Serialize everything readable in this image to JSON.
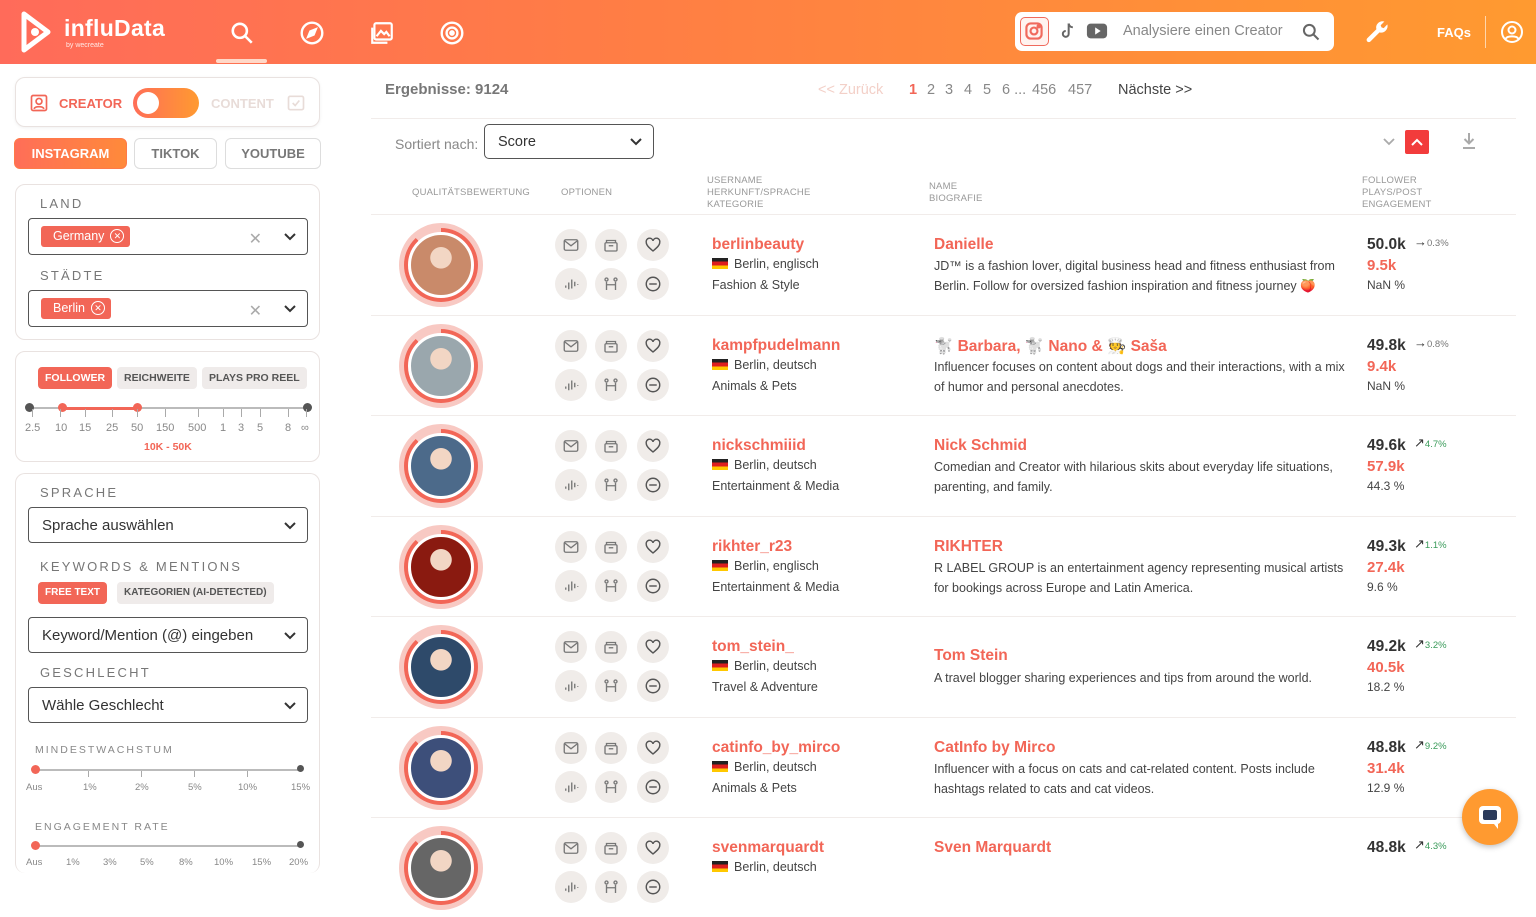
{
  "app": {
    "brand": "influData",
    "brand_sub": "by wecreate"
  },
  "topbar": {
    "nav_icons": [
      "search-icon",
      "compass-icon",
      "gallery-icon",
      "campaign-icon"
    ],
    "search_placeholder": "Analysiere einen Creator",
    "platform_icons": [
      "instagram-icon",
      "tiktok-icon",
      "youtube-icon"
    ],
    "faqs_label": "FAQs"
  },
  "sidebar": {
    "creator_label": "CREATOR",
    "content_label": "CONTENT",
    "platform_tabs": [
      "INSTAGRAM",
      "TIKTOK",
      "YOUTUBE"
    ],
    "land": {
      "title": "LAND",
      "chip": "Germany"
    },
    "staedte": {
      "title": "STÄDTE",
      "chip": "Berlin"
    },
    "metric_tabs": [
      "FOLLOWER",
      "REICHWEITE",
      "PLAYS PRO REEL"
    ],
    "follower_ticks": [
      "2.5",
      "10",
      "15",
      "25",
      "50",
      "150",
      "500",
      "1",
      "3",
      "5",
      "8",
      "∞"
    ],
    "follower_range": "10K - 50K",
    "sprache": {
      "title": "SPRACHE",
      "placeholder": "Sprache auswählen"
    },
    "keywords": {
      "title": "KEYWORDS & MENTIONS",
      "tabs": [
        "FREE TEXT",
        "KATEGORIEN (AI-DETECTED)"
      ],
      "placeholder": "Keyword/Mention (@) eingeben"
    },
    "geschlecht": {
      "title": "GESCHLECHT",
      "placeholder": "Wähle Geschlecht"
    },
    "wachstum": {
      "title": "MINDESTWACHSTUM",
      "ticks": [
        "Aus",
        "1%",
        "2%",
        "5%",
        "10%",
        "15%"
      ]
    },
    "engagement": {
      "title": "ENGAGEMENT RATE",
      "ticks": [
        "Aus",
        "1%",
        "3%",
        "5%",
        "8%",
        "10%",
        "15%",
        "20%"
      ]
    }
  },
  "main": {
    "results_label": "Ergebnisse: 9124",
    "pagination": {
      "prev": "<< Zurück",
      "pages": [
        "1",
        "2",
        "3",
        "4",
        "5",
        "6 ...",
        "456",
        "457"
      ],
      "current": "1",
      "next": "Nächste >>"
    },
    "sort": {
      "label": "Sortiert nach:",
      "value": "Score"
    },
    "headers": {
      "quality": "QUALITÄTSBEWERTUNG",
      "options": "OPTIONEN",
      "user": [
        "USERNAME",
        "HERKUNFT/SPRACHE",
        "KATEGORIE"
      ],
      "name": [
        "NAME",
        "BIOGRAFIE"
      ],
      "stats": [
        "FOLLOWER",
        "PLAYS/POST",
        "ENGAGEMENT"
      ]
    },
    "rows": [
      {
        "username": "berlinbeauty",
        "origin": "Berlin, englisch",
        "category": "Fashion & Style",
        "name": "Danielle",
        "bio": "JD™ is a fashion lover, digital business head and fitness enthusiast from Berlin. Follow for oversized fashion inspiration and fitness journey 🍑",
        "followers": "50.0k",
        "growth": "0.3%",
        "growth_dir": "flat",
        "plays": "9.5k",
        "engagement": "NaN %",
        "avatar_color": "#c98a6a"
      },
      {
        "username": "kampfpudelmann",
        "origin": "Berlin, deutsch",
        "category": "Animals & Pets",
        "name": "🐩 Barbara, 🐩 Nano & 🧑‍🍳 Saša",
        "bio": "Influencer focuses on content about dogs and their interactions, with a mix of humor and personal anecdotes.",
        "followers": "49.8k",
        "growth": "0.8%",
        "growth_dir": "flat",
        "plays": "9.4k",
        "engagement": "NaN %",
        "avatar_color": "#9aa7ad"
      },
      {
        "username": "nickschmiiid",
        "origin": "Berlin, deutsch",
        "category": "Entertainment & Media",
        "name": "Nick Schmid",
        "bio": "Comedian and Creator with hilarious skits about everyday life situations, parenting, and family.",
        "followers": "49.6k",
        "growth": "4.7%",
        "growth_dir": "up",
        "plays": "57.9k",
        "engagement": "44.3 %",
        "avatar_color": "#4c6a8a"
      },
      {
        "username": "rikhter_r23",
        "origin": "Berlin, englisch",
        "category": "Entertainment & Media",
        "name": "RIKHTER",
        "bio": "R LABEL GROUP is an entertainment agency representing musical artists for bookings across Europe and Latin America.",
        "followers": "49.3k",
        "growth": "1.1%",
        "growth_dir": "up",
        "plays": "27.4k",
        "engagement": "9.6 %",
        "avatar_color": "#8a1a10"
      },
      {
        "username": "tom_stein_",
        "origin": "Berlin, deutsch",
        "category": "Travel & Adventure",
        "name": "Tom Stein",
        "bio": "A travel blogger sharing experiences and tips from around the world.",
        "followers": "49.2k",
        "growth": "3.2%",
        "growth_dir": "up",
        "plays": "40.5k",
        "engagement": "18.2 %",
        "avatar_color": "#2e4a6a"
      },
      {
        "username": "catinfo_by_mirco",
        "origin": "Berlin, deutsch",
        "category": "Animals & Pets",
        "name": "CatInfo by Mirco",
        "bio": "Influencer with a focus on cats and cat-related content. Posts include hashtags related to cats and cat videos.",
        "followers": "48.8k",
        "growth": "9.2%",
        "growth_dir": "up",
        "plays": "31.4k",
        "engagement": "12.9 %",
        "avatar_color": "#3d4f7a"
      },
      {
        "username": "svenmarquardt",
        "origin": "Berlin, deutsch",
        "category": "",
        "name": "Sven Marquardt",
        "bio": "",
        "followers": "48.8k",
        "growth": "4.3%",
        "growth_dir": "up",
        "plays": "",
        "engagement": "",
        "avatar_color": "#666666"
      }
    ]
  }
}
